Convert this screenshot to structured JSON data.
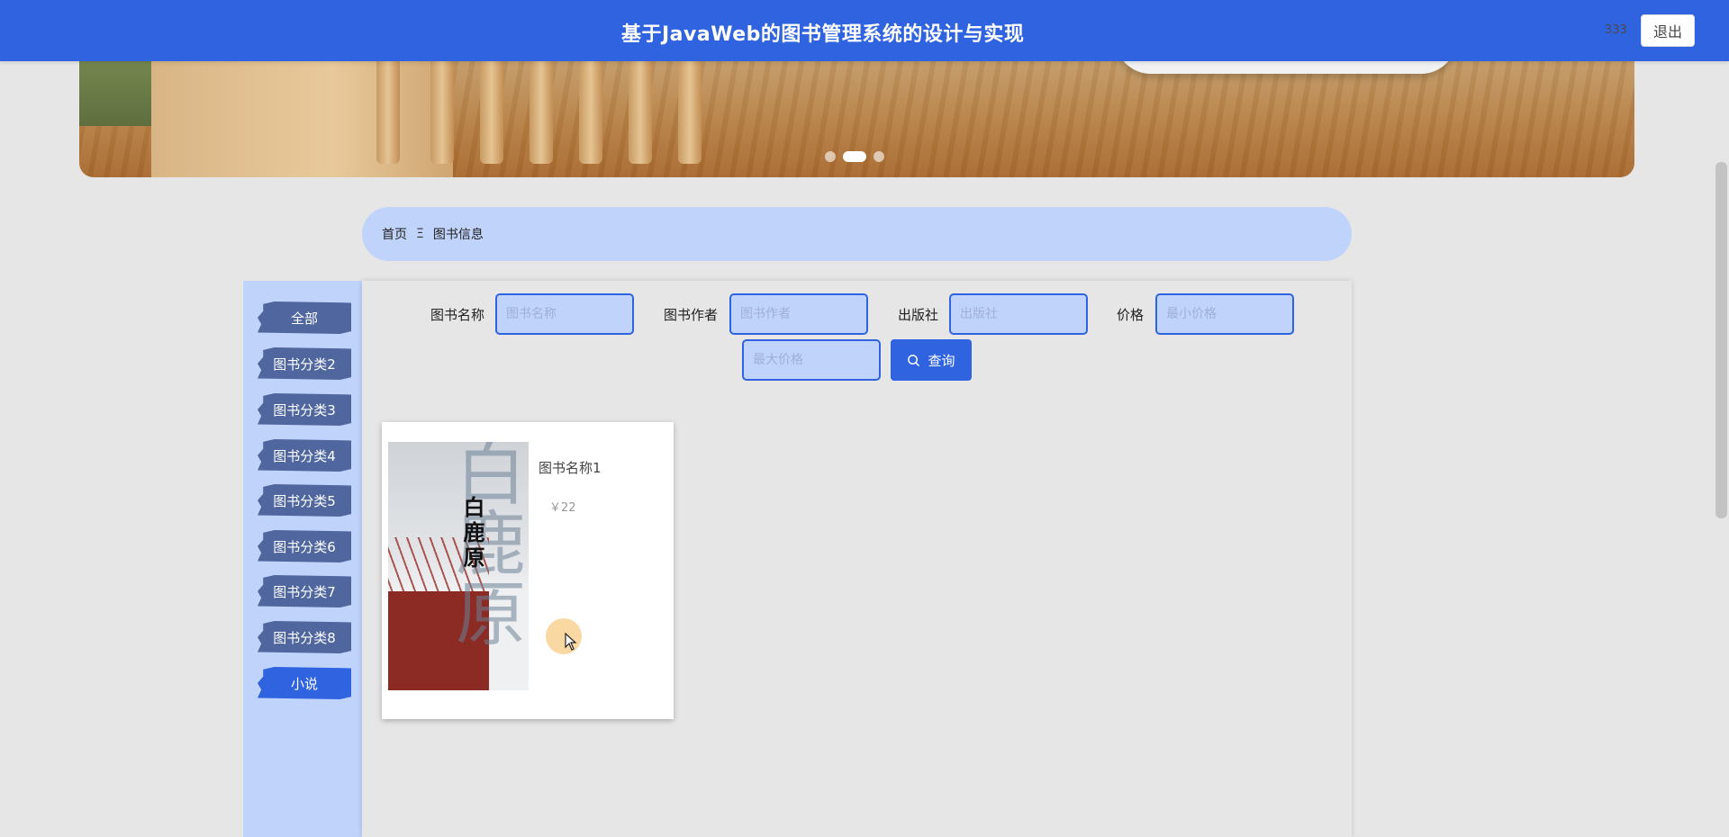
{
  "header": {
    "title": "基于JavaWeb的图书管理系统的设计与实现",
    "user_label": "333",
    "logout_label": "退出"
  },
  "banner": {
    "slide_count": 3,
    "active_slide": 2
  },
  "breadcrumb": {
    "home": "首页",
    "separator": "Ξ",
    "current": "图书信息"
  },
  "sidebar": {
    "categories": [
      {
        "label": "全部",
        "active": false
      },
      {
        "label": "图书分类2",
        "active": false
      },
      {
        "label": "图书分类3",
        "active": false
      },
      {
        "label": "图书分类4",
        "active": false
      },
      {
        "label": "图书分类5",
        "active": false
      },
      {
        "label": "图书分类6",
        "active": false
      },
      {
        "label": "图书分类7",
        "active": false
      },
      {
        "label": "图书分类8",
        "active": false
      },
      {
        "label": "小说",
        "active": true
      }
    ]
  },
  "filters": {
    "name_label": "图书名称",
    "name_placeholder": "图书名称",
    "name_value": "",
    "author_label": "图书作者",
    "author_placeholder": "图书作者",
    "author_value": "",
    "publisher_label": "出版社",
    "publisher_placeholder": "出版社",
    "publisher_value": "",
    "price_label": "价格",
    "min_price_placeholder": "最小价格",
    "min_price_value": "",
    "max_price_placeholder": "最大价格",
    "max_price_value": "",
    "search_label": "查询"
  },
  "books": [
    {
      "name": "图书名称1",
      "price": "￥22",
      "cover_title": "白鹿原"
    }
  ],
  "colors": {
    "primary": "#2f63e0",
    "light_blue": "#c0d3fb",
    "sidebar_item": "#4f679e",
    "background": "#e6e6e6"
  }
}
